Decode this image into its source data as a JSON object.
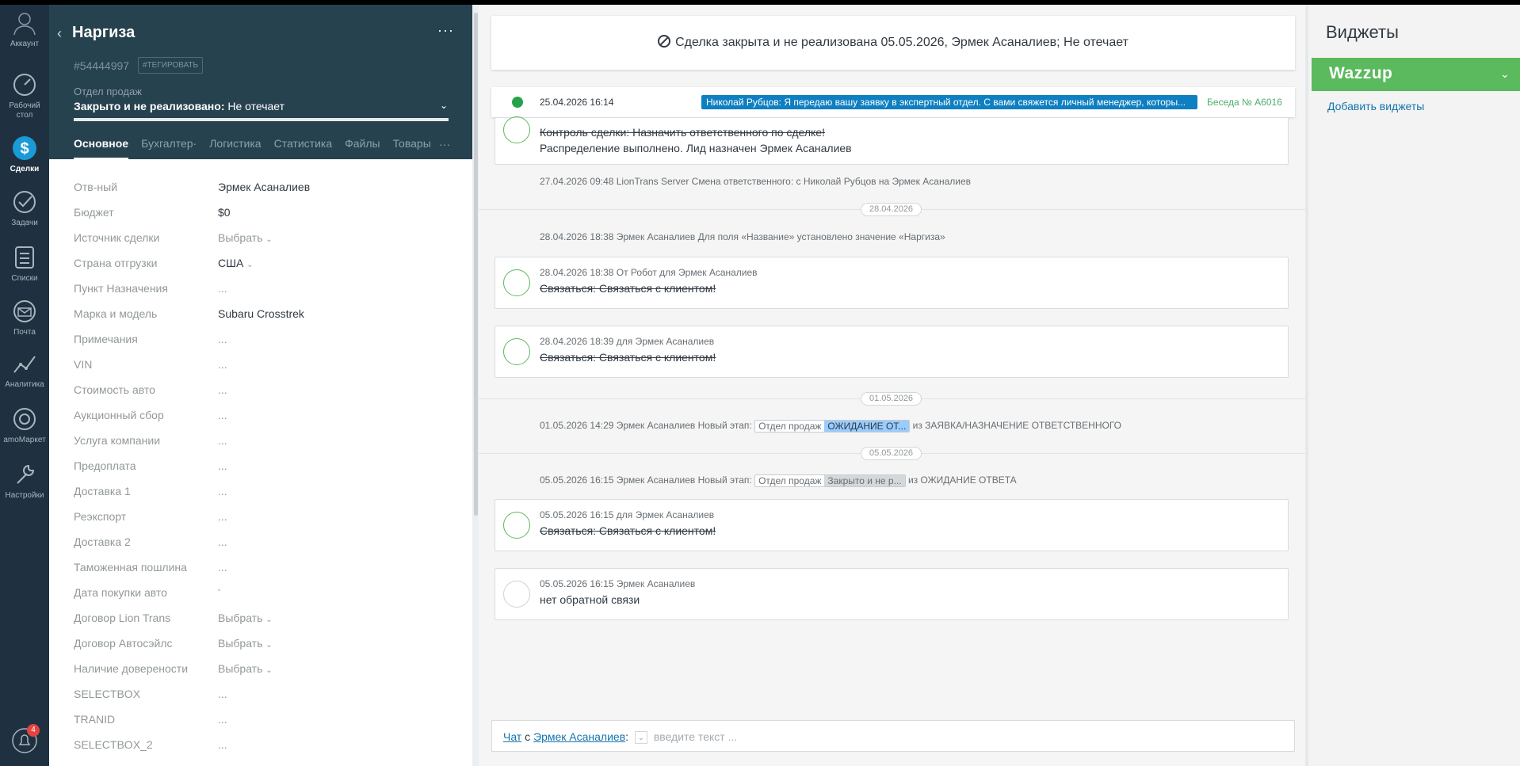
{
  "nav": {
    "account": "Аккаунт",
    "dashboard": "Рабочий стол",
    "deals": "Сделки",
    "tasks": "Задачи",
    "lists": "Списки",
    "mail": "Почта",
    "analytics": "Аналитика",
    "market": "amoМаркет",
    "settings": "Настройки",
    "notifications_count": "4"
  },
  "card": {
    "title": "Наргиза",
    "more": "···",
    "deal_id": "#54444997",
    "tag_button": "#ТЕГИРОВАТЬ",
    "pipeline": "Отдел продаж",
    "status_bold": "Закрыто и не реализовано:",
    "status_reason": " Не отечает",
    "tabs": [
      "Основное",
      "Бухгалтер·",
      "Логистика",
      "Статистика",
      "Файлы",
      "Товары"
    ],
    "tabs_more": "···",
    "fields": [
      {
        "label": "Отв-ный",
        "value": "Эрмек Асаналиев"
      },
      {
        "label": "Бюджет",
        "value": "$0"
      },
      {
        "label": "Источник сделки",
        "value": "Выбрать"
      },
      {
        "label": "Страна отгрузки",
        "value": "США"
      },
      {
        "label": "Пункт Назначения",
        "value": "..."
      },
      {
        "label": "Марка и модель",
        "value": "Subaru Crosstrek"
      },
      {
        "label": "Примечания",
        "value": "..."
      },
      {
        "label": "VIN",
        "value": "..."
      },
      {
        "label": "Стоимость авто",
        "value": "..."
      },
      {
        "label": "Аукционный сбор",
        "value": "..."
      },
      {
        "label": "Услуга компании",
        "value": "..."
      },
      {
        "label": "Предоплата",
        "value": "..."
      },
      {
        "label": "Доставка 1",
        "value": "..."
      },
      {
        "label": "Реэкспорт",
        "value": "..."
      },
      {
        "label": "Доставка 2",
        "value": "..."
      },
      {
        "label": "Таможенная пошлина",
        "value": "..."
      },
      {
        "label": "Дата покупки авто",
        "value": "▫"
      },
      {
        "label": "Договор Lion Trans",
        "value": "Выбрать"
      },
      {
        "label": "Договор Автосэйлс",
        "value": "Выбрать"
      },
      {
        "label": "Наличие доверености",
        "value": "Выбрать"
      },
      {
        "label": "SELECTBOX",
        "value": "..."
      },
      {
        "label": "TRANID",
        "value": "..."
      },
      {
        "label": "SELECTBOX_2",
        "value": "..."
      }
    ]
  },
  "feed": {
    "closed_banner": "Сделка закрыта и не реализована 05.05.2026, Эрмек Асаналиев; Не отечает",
    "whatsapp": {
      "time": "25.04.2026 16:14",
      "message": "Николай Рубцов: Я передаю вашу заявку в экспертный отдел. С вами свяжется личный менеджер, которы...",
      "conversation": "Беседа № A6016"
    },
    "task1_line1": "Контроль сделки: Назначить ответственного по сделке!",
    "task1_line2": "Распределение выполнено. Лид назначен Эрмек Асаналиев",
    "event_resp": "27.04.2026 09:48 LionTrans Server Смена ответственного: с Николай Рубцов на Эрмек Асаналиев",
    "date_2804": "28.04.2026",
    "event_name": "28.04.2026 18:38 Эрмек Асаналиев Для поля «Название» установлено значение «Наргиза»",
    "task2_meta": "28.04.2026 18:38  От Робот для Эрмек Асаналиев",
    "task2_text": "Связаться: Связаться с клиентом!",
    "task3_meta": "28.04.2026 18:39  для Эрмек Асаналиев",
    "task3_text": "Связаться: Связаться с клиентом!",
    "date_0105": "01.05.2026",
    "event_stage1_prefix": "01.05.2026 14:29 Эрмек Асаналиев Новый этап:",
    "stage1_pipeline": "Отдел продаж",
    "stage1_name": "ОЖИДАНИЕ ОТ...",
    "event_stage1_suffix": "из ЗАЯВКА/НАЗНАЧЕНИЕ ОТВЕТСТВЕННОГО",
    "date_0505": "05.05.2026",
    "event_stage2_prefix": "05.05.2026 16:15 Эрмек Асаналиев Новый этап:",
    "stage2_pipeline": "Отдел продаж",
    "stage2_name": "Закрыто и не р...",
    "event_stage2_suffix": "из ОЖИДАНИЕ ОТВЕТА",
    "task4_meta": "05.05.2026 16:15  для Эрмек Асаналиев",
    "task4_text": "Связаться: Связаться с клиентом!",
    "note_meta": "05.05.2026 16:15 Эрмек Асаналиев",
    "note_text": "нет обратной связи",
    "chat_link": "Чат",
    "chat_with": " с ",
    "chat_user": "Эрмек Асаналиев",
    "chat_colon": ":",
    "chat_placeholder": "введите текст ..."
  },
  "widgets": {
    "title": "Виджеты",
    "wazzup": "Wazzup",
    "add": "Добавить виджеты"
  },
  "colors": {
    "nav_bg": "#1f3140",
    "card_head_bg": "#26424f",
    "accent_link": "#1375ab",
    "whatsapp_msg": "#0e7fc0",
    "wazzup": "#5bb95e",
    "task_done": "#5bb95e",
    "stage_waiting": "#99ccff"
  }
}
